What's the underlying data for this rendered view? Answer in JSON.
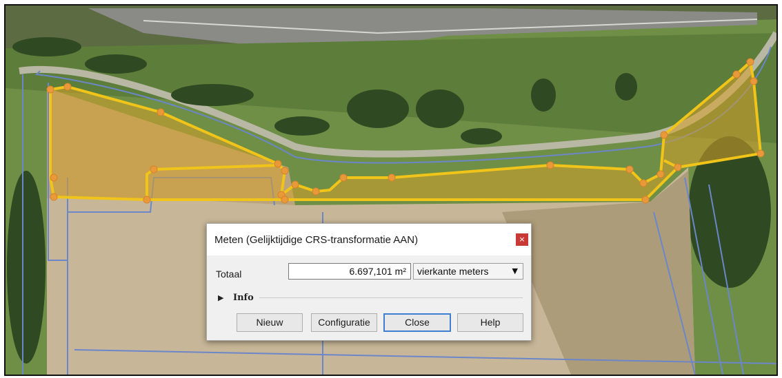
{
  "map": {
    "description_icons": "aerial-photo-map",
    "measure_fill_color": "#d6a12a",
    "measure_stroke_color": "#f0c419",
    "parcel_line_color": "#6b86c9"
  },
  "dialog": {
    "title": "Meten (Gelijktijdige CRS-transformatie AAN)",
    "close_glyph": "×",
    "total_label": "Totaal",
    "total_value": "6.697,101 m²",
    "unit_selected": "vierkante meters",
    "unit_caret_glyph": "▼",
    "info_arrow_glyph": "▶",
    "info_label": "Info",
    "buttons": {
      "new": "Nieuw",
      "config": "Configuratie",
      "close": "Close",
      "help": "Help"
    }
  }
}
